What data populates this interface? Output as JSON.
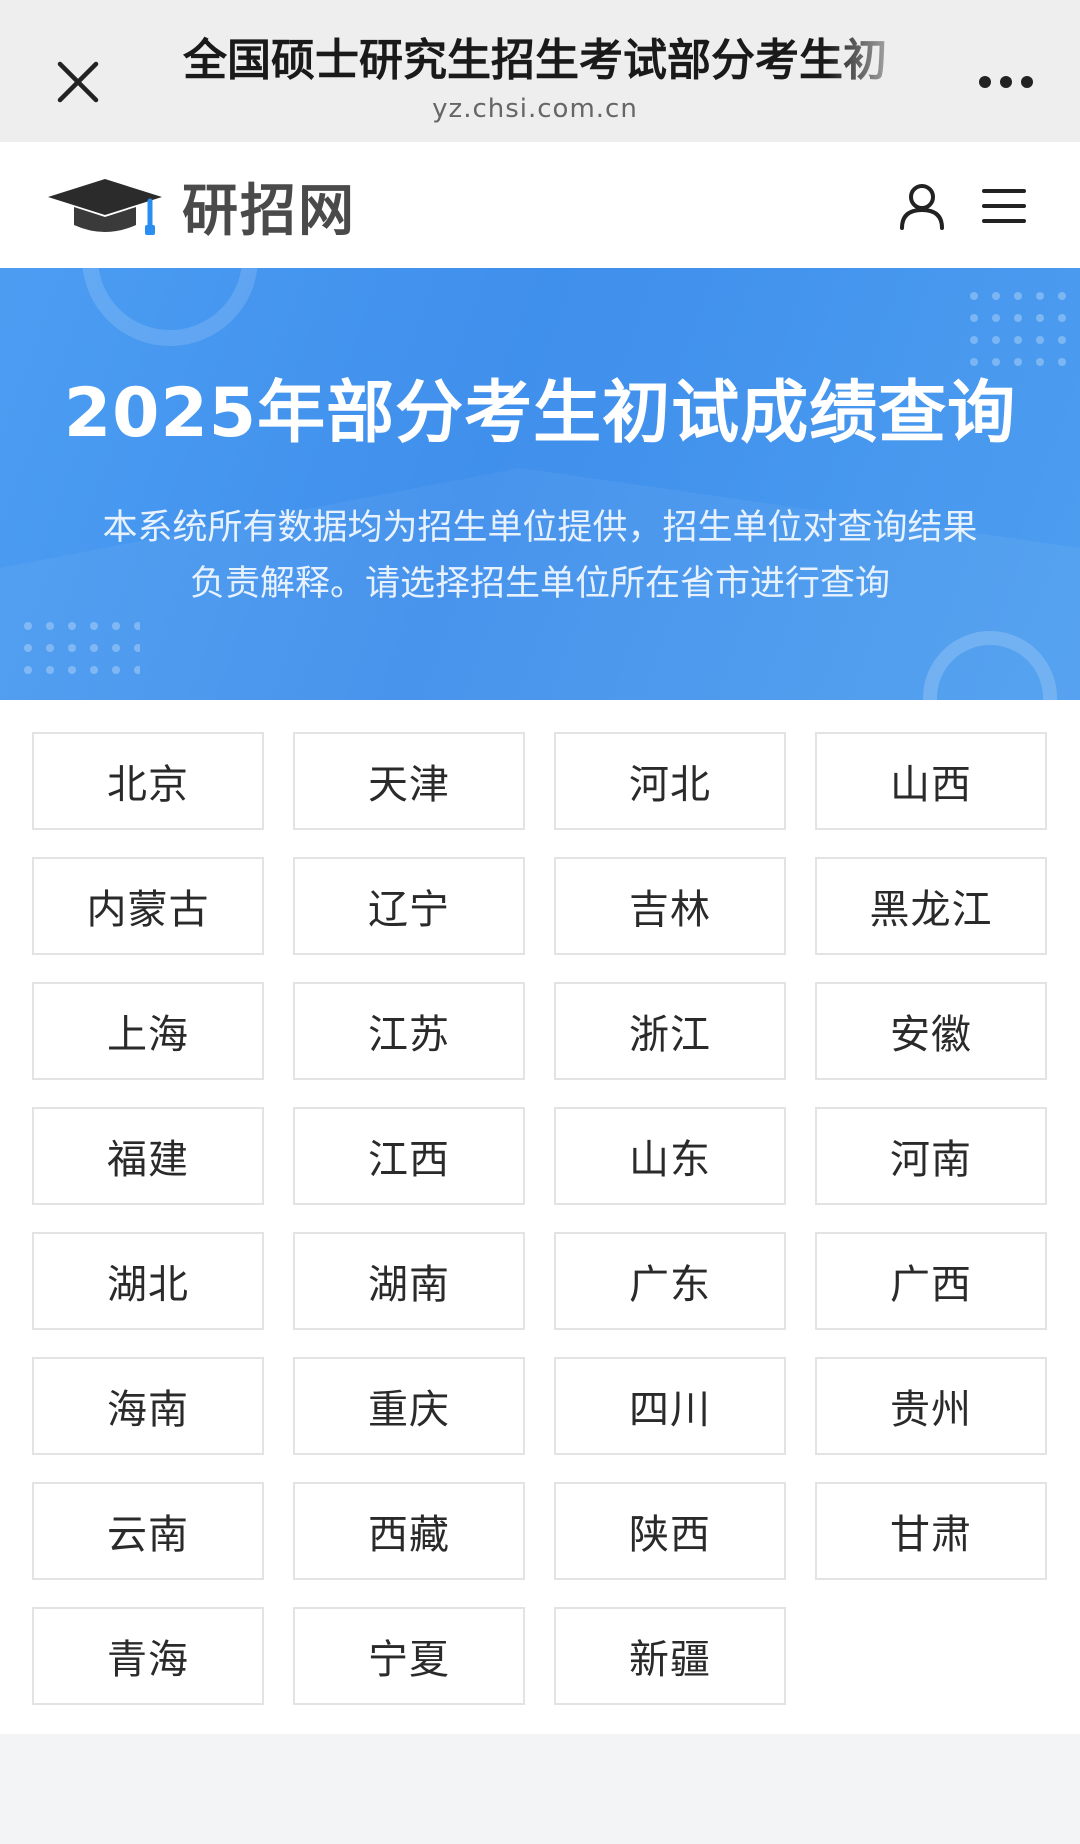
{
  "browser": {
    "title": "全国硕士研究生招生考试部分考生初",
    "url": "yz.chsi.com.cn"
  },
  "site": {
    "logo_text": "研招网"
  },
  "banner": {
    "title": "2025年部分考生初试成绩查询",
    "description_line1": "本系统所有数据均为招生单位提供，招生单位对查询结果",
    "description_line2": "负责解释。请选择招生单位所在省市进行查询"
  },
  "provinces": [
    "北京",
    "天津",
    "河北",
    "山西",
    "内蒙古",
    "辽宁",
    "吉林",
    "黑龙江",
    "上海",
    "江苏",
    "浙江",
    "安徽",
    "福建",
    "江西",
    "山东",
    "河南",
    "湖北",
    "湖南",
    "广东",
    "广西",
    "海南",
    "重庆",
    "四川",
    "贵州",
    "云南",
    "西藏",
    "陕西",
    "甘肃",
    "青海",
    "宁夏",
    "新疆"
  ],
  "colors": {
    "banner": "#4596ee",
    "logo_accent": "#2a8ef0"
  },
  "icons": [
    "close-icon",
    "more-icon",
    "graduation-cap-icon",
    "user-icon",
    "menu-icon"
  ]
}
